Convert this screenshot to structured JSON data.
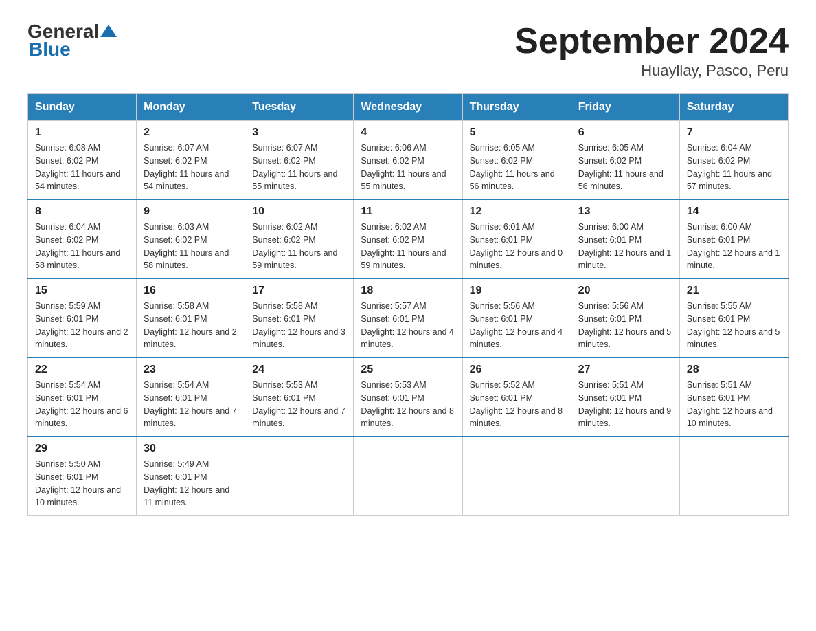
{
  "header": {
    "logo_general": "General",
    "logo_blue": "Blue",
    "title": "September 2024",
    "subtitle": "Huayllay, Pasco, Peru"
  },
  "calendar": {
    "days_of_week": [
      "Sunday",
      "Monday",
      "Tuesday",
      "Wednesday",
      "Thursday",
      "Friday",
      "Saturday"
    ],
    "weeks": [
      [
        {
          "day": "1",
          "sunrise": "6:08 AM",
          "sunset": "6:02 PM",
          "daylight": "11 hours and 54 minutes."
        },
        {
          "day": "2",
          "sunrise": "6:07 AM",
          "sunset": "6:02 PM",
          "daylight": "11 hours and 54 minutes."
        },
        {
          "day": "3",
          "sunrise": "6:07 AM",
          "sunset": "6:02 PM",
          "daylight": "11 hours and 55 minutes."
        },
        {
          "day": "4",
          "sunrise": "6:06 AM",
          "sunset": "6:02 PM",
          "daylight": "11 hours and 55 minutes."
        },
        {
          "day": "5",
          "sunrise": "6:05 AM",
          "sunset": "6:02 PM",
          "daylight": "11 hours and 56 minutes."
        },
        {
          "day": "6",
          "sunrise": "6:05 AM",
          "sunset": "6:02 PM",
          "daylight": "11 hours and 56 minutes."
        },
        {
          "day": "7",
          "sunrise": "6:04 AM",
          "sunset": "6:02 PM",
          "daylight": "11 hours and 57 minutes."
        }
      ],
      [
        {
          "day": "8",
          "sunrise": "6:04 AM",
          "sunset": "6:02 PM",
          "daylight": "11 hours and 58 minutes."
        },
        {
          "day": "9",
          "sunrise": "6:03 AM",
          "sunset": "6:02 PM",
          "daylight": "11 hours and 58 minutes."
        },
        {
          "day": "10",
          "sunrise": "6:02 AM",
          "sunset": "6:02 PM",
          "daylight": "11 hours and 59 minutes."
        },
        {
          "day": "11",
          "sunrise": "6:02 AM",
          "sunset": "6:02 PM",
          "daylight": "11 hours and 59 minutes."
        },
        {
          "day": "12",
          "sunrise": "6:01 AM",
          "sunset": "6:01 PM",
          "daylight": "12 hours and 0 minutes."
        },
        {
          "day": "13",
          "sunrise": "6:00 AM",
          "sunset": "6:01 PM",
          "daylight": "12 hours and 1 minute."
        },
        {
          "day": "14",
          "sunrise": "6:00 AM",
          "sunset": "6:01 PM",
          "daylight": "12 hours and 1 minute."
        }
      ],
      [
        {
          "day": "15",
          "sunrise": "5:59 AM",
          "sunset": "6:01 PM",
          "daylight": "12 hours and 2 minutes."
        },
        {
          "day": "16",
          "sunrise": "5:58 AM",
          "sunset": "6:01 PM",
          "daylight": "12 hours and 2 minutes."
        },
        {
          "day": "17",
          "sunrise": "5:58 AM",
          "sunset": "6:01 PM",
          "daylight": "12 hours and 3 minutes."
        },
        {
          "day": "18",
          "sunrise": "5:57 AM",
          "sunset": "6:01 PM",
          "daylight": "12 hours and 4 minutes."
        },
        {
          "day": "19",
          "sunrise": "5:56 AM",
          "sunset": "6:01 PM",
          "daylight": "12 hours and 4 minutes."
        },
        {
          "day": "20",
          "sunrise": "5:56 AM",
          "sunset": "6:01 PM",
          "daylight": "12 hours and 5 minutes."
        },
        {
          "day": "21",
          "sunrise": "5:55 AM",
          "sunset": "6:01 PM",
          "daylight": "12 hours and 5 minutes."
        }
      ],
      [
        {
          "day": "22",
          "sunrise": "5:54 AM",
          "sunset": "6:01 PM",
          "daylight": "12 hours and 6 minutes."
        },
        {
          "day": "23",
          "sunrise": "5:54 AM",
          "sunset": "6:01 PM",
          "daylight": "12 hours and 7 minutes."
        },
        {
          "day": "24",
          "sunrise": "5:53 AM",
          "sunset": "6:01 PM",
          "daylight": "12 hours and 7 minutes."
        },
        {
          "day": "25",
          "sunrise": "5:53 AM",
          "sunset": "6:01 PM",
          "daylight": "12 hours and 8 minutes."
        },
        {
          "day": "26",
          "sunrise": "5:52 AM",
          "sunset": "6:01 PM",
          "daylight": "12 hours and 8 minutes."
        },
        {
          "day": "27",
          "sunrise": "5:51 AM",
          "sunset": "6:01 PM",
          "daylight": "12 hours and 9 minutes."
        },
        {
          "day": "28",
          "sunrise": "5:51 AM",
          "sunset": "6:01 PM",
          "daylight": "12 hours and 10 minutes."
        }
      ],
      [
        {
          "day": "29",
          "sunrise": "5:50 AM",
          "sunset": "6:01 PM",
          "daylight": "12 hours and 10 minutes."
        },
        {
          "day": "30",
          "sunrise": "5:49 AM",
          "sunset": "6:01 PM",
          "daylight": "12 hours and 11 minutes."
        },
        null,
        null,
        null,
        null,
        null
      ]
    ],
    "labels": {
      "sunrise": "Sunrise:",
      "sunset": "Sunset:",
      "daylight": "Daylight:"
    }
  }
}
